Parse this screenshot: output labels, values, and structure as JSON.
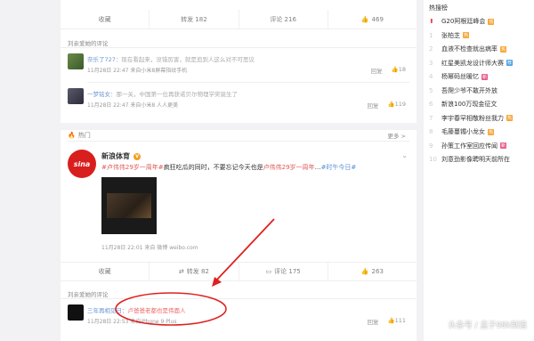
{
  "actions_top": {
    "fav": "收藏",
    "repost": "转发 182",
    "comment": "评论 216",
    "like": "469"
  },
  "comments_top": {
    "header": "刘亲爱她的评论",
    "c1": {
      "user": "奈乐了727",
      "text": "：现在看起来，没错厉害，就是追到人这么对不可思议",
      "meta": "11月28日 22:47 来自小米8屏幕指纹手机",
      "reply": "回复",
      "likes": "18"
    },
    "c2": {
      "user": "一梦铭女",
      "text": "：那一关，中国第一位再获诺贝尔物理学奖诞生了",
      "meta": "11月28日 22:47 来自小米8 人人更美",
      "reply": "回复",
      "likes": "119"
    }
  },
  "hot": {
    "label": "热门",
    "more": "更多 >"
  },
  "post": {
    "logo": "sina",
    "user": "新浪体育",
    "badge": "V",
    "text_tag1": "#卢伟伟29岁一周年#",
    "text_mid": "疯狂吃瓜的同时，不要忘记今天也是",
    "text_tag2": "卢伟伟29岁一周年",
    "text_tail": "…",
    "text_tag3": "#时午今日#",
    "meta": "11月28日 22:01 来自 微博 weibo.com"
  },
  "actions_post": {
    "fav": "收藏",
    "repost": "转发 82",
    "comment": "评论 175",
    "like": "263"
  },
  "comments_bottom": {
    "header": "刘亲爱她的评论",
    "c1": {
      "user": "三年再相见日",
      "text": "：卢爸爸老都也是伟面人",
      "meta": "11月28日 22:53 来自iPhone 9 Plus",
      "reply": "回复",
      "likes": "111"
    }
  },
  "sidebar": {
    "title": "热搜榜",
    "items": [
      {
        "num": "",
        "text": "G20阿根廷峰会",
        "badge": "热",
        "color": "#f7a330"
      },
      {
        "num": "1",
        "text": "张柏芝",
        "badge": "热",
        "color": "#f7a330"
      },
      {
        "num": "2",
        "text": "血液不检查就出病率",
        "badge": "热",
        "color": "#f7a330"
      },
      {
        "num": "3",
        "text": "红星美凯龙设计师大赛",
        "badge": "荐",
        "color": "#4da3e8"
      },
      {
        "num": "4",
        "text": "杨幂码丝暖忆",
        "badge": "新",
        "color": "#e85a8a"
      },
      {
        "num": "5",
        "text": "吾爬少爷不敢开外放",
        "badge": "",
        "color": ""
      },
      {
        "num": "6",
        "text": "新浪100万现金征文",
        "badge": "",
        "color": ""
      },
      {
        "num": "7",
        "text": "李宇春罕相敬粉丝我力",
        "badge": "热",
        "color": "#f7a330"
      },
      {
        "num": "8",
        "text": "毛藤蔓镯小龙女",
        "badge": "热",
        "color": "#f7a330"
      },
      {
        "num": "9",
        "text": "孙策工作室回应传闻",
        "badge": "新",
        "color": "#e85a8a"
      },
      {
        "num": "10",
        "text": "刘意劲影像聘明天前所在",
        "badge": "",
        "color": ""
      }
    ]
  },
  "watermark": "头条号 / 孟子98k制造"
}
